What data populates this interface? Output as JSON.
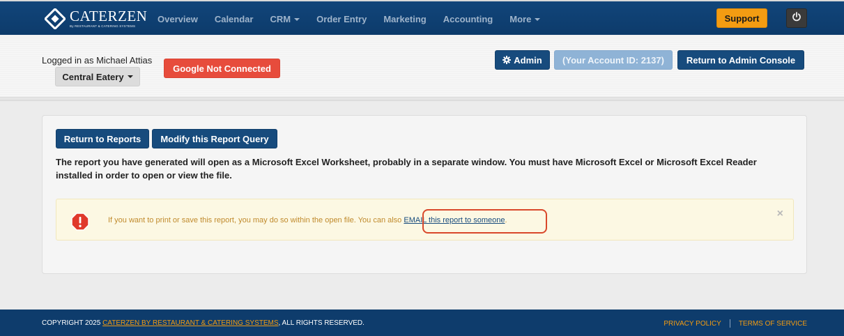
{
  "navbar": {
    "logo_text": "CATERZEN",
    "logo_subtext": "By RESTAURANT & CATERING SYSTEMS",
    "links": [
      "Overview",
      "Calendar",
      "CRM",
      "Order Entry",
      "Marketing",
      "Accounting",
      "More"
    ],
    "support_label": "Support"
  },
  "header": {
    "logged_in": "Logged in as Michael Attias",
    "location": "Central Eatery",
    "google_status": "Google Not Connected",
    "admin_label": "Admin",
    "account_id": "(Your Account ID: 2137)",
    "return_admin_label": "Return to Admin Console"
  },
  "main": {
    "return_reports_label": "Return to Reports",
    "modify_query_label": "Modify this Report Query",
    "description": "The report you have generated will open as a Microsoft Excel Worksheet, probably in a separate window. You must have Microsoft Excel or Microsoft Excel Reader installed in order to open or view the file.",
    "alert": {
      "text_before": "If you want to print or save this report, you may do so within the open file. You can also ",
      "link_text": "EMAIL this report to someone",
      "text_after": ".",
      "close": "×"
    }
  },
  "footer": {
    "copyright_prefix": "COPYRIGHT 2025 ",
    "company_link": "CATERZEN BY RESTAURANT & CATERING SYSTEMS",
    "copyright_suffix": ", ALL RIGHTS RESERVED.",
    "privacy": "PRIVACY POLICY",
    "terms": "TERMS OF SERVICE"
  },
  "colors": {
    "navbar": "#0e3c6c",
    "primary_button": "#174b7d",
    "support": "#f39c12",
    "google_error": "#e74c3c",
    "alert_bg": "#fcf8e3",
    "highlight": "#d9482b"
  },
  "icons": [
    "logo-diamond-icon",
    "power-icon",
    "gear-icon",
    "alert-octagon-icon",
    "close-icon",
    "caret-down-icon"
  ]
}
